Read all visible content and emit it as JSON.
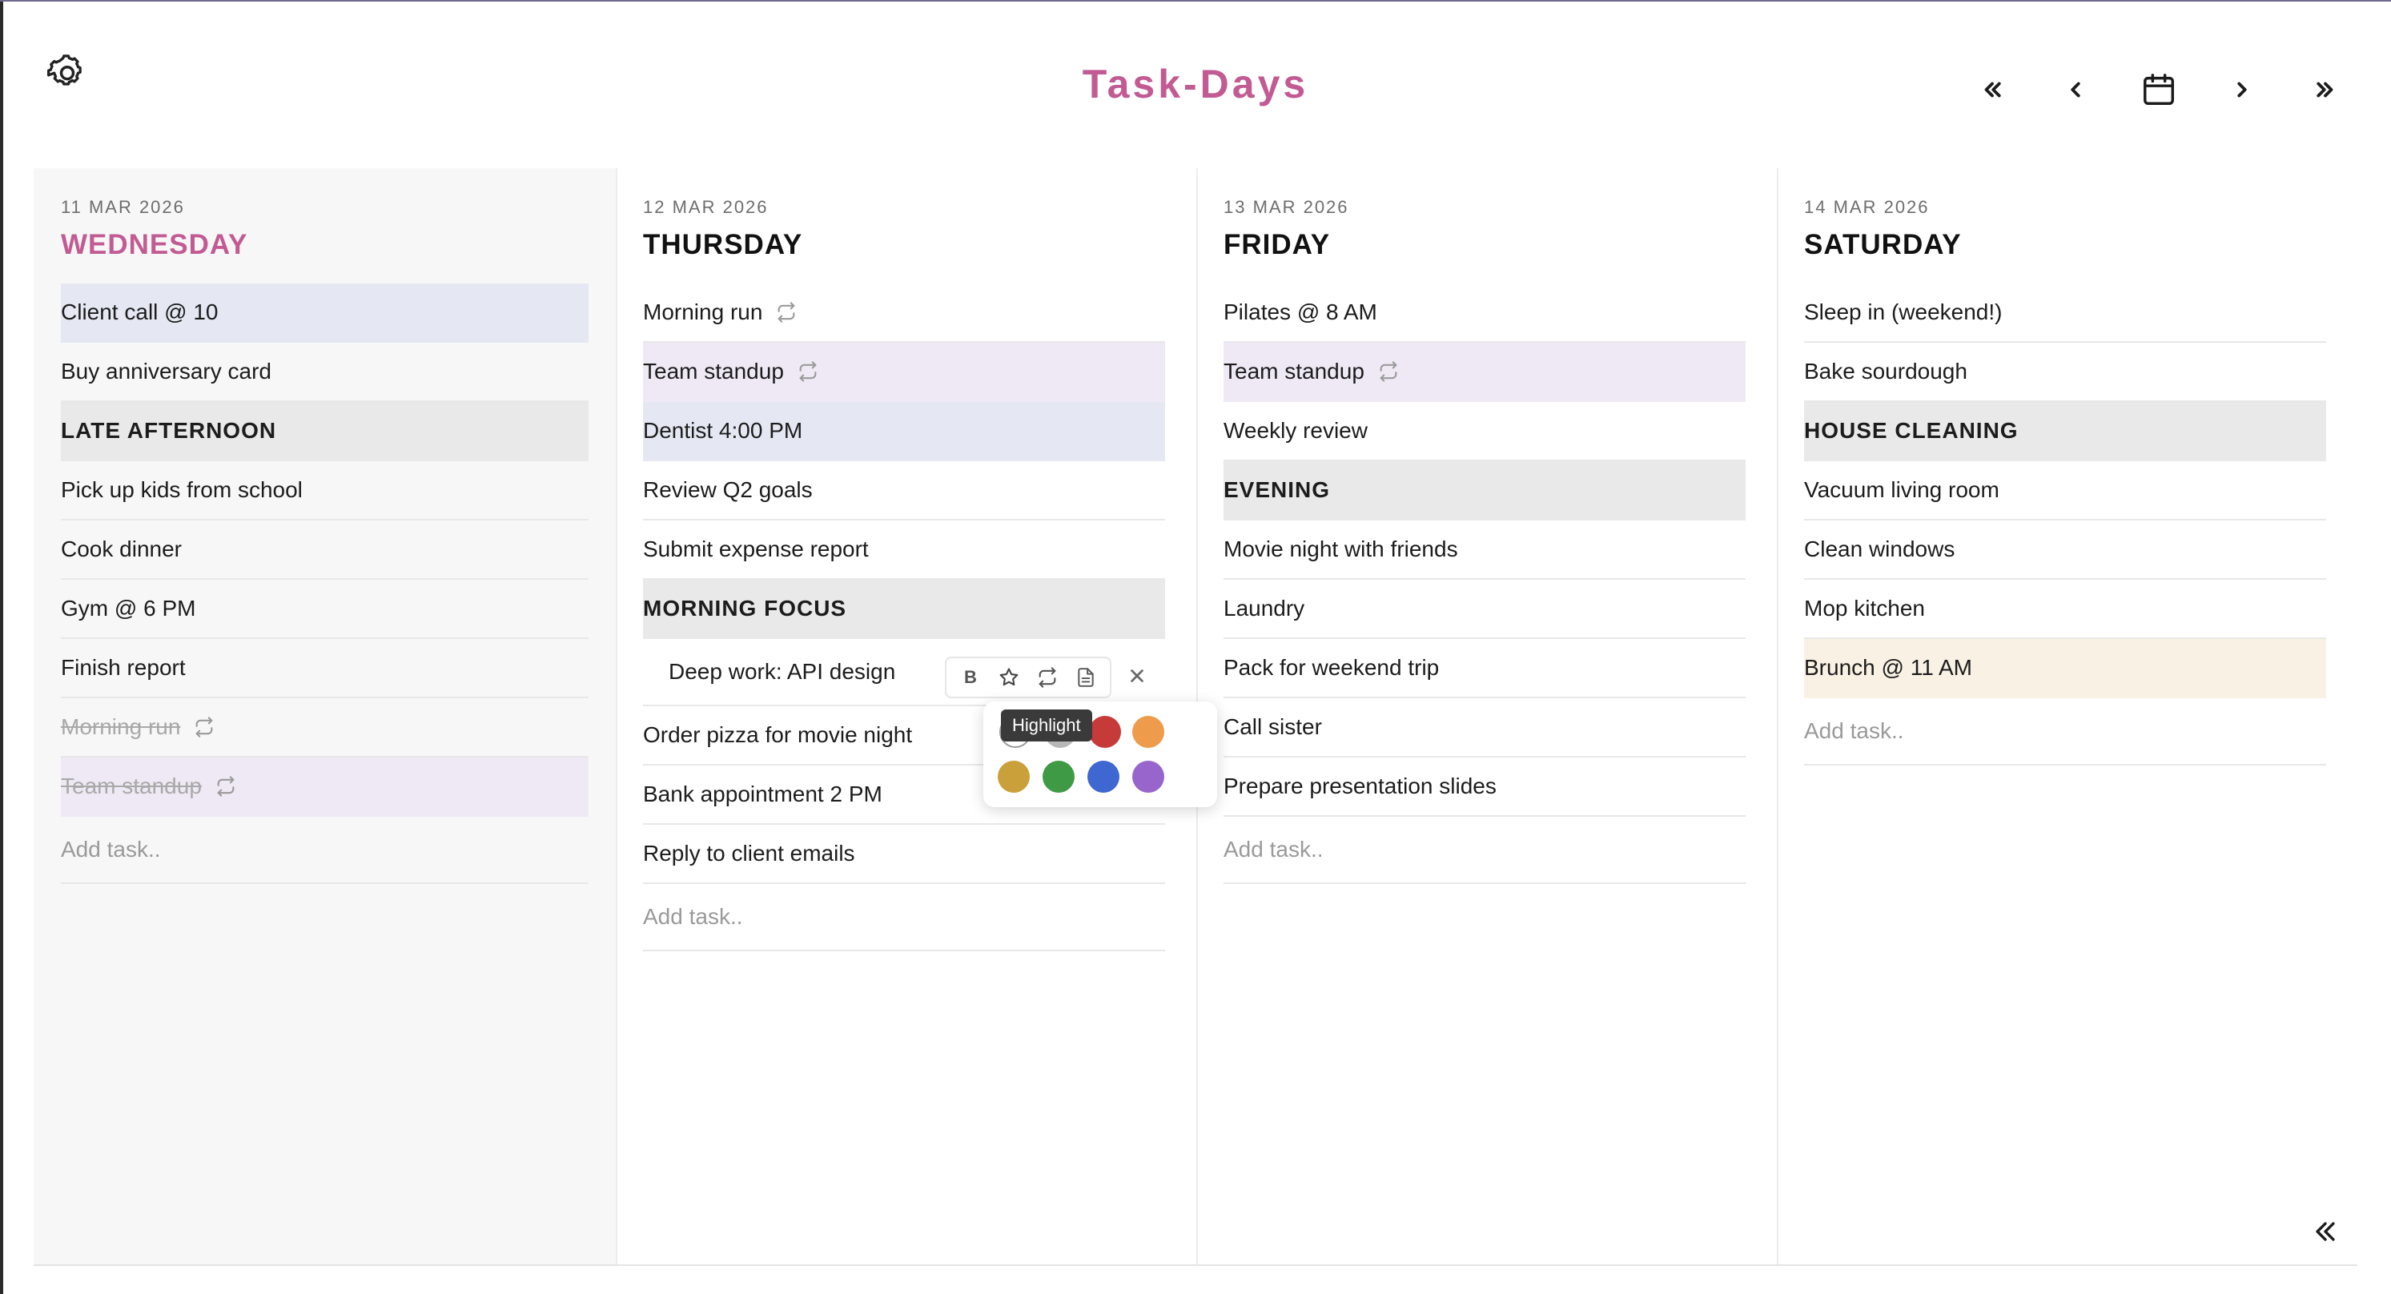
{
  "app": {
    "title": "Task-Days"
  },
  "header": {
    "settings_icon": "gear-icon",
    "nav": [
      {
        "name": "jump-back-button",
        "icon": "double-chevron-left-icon"
      },
      {
        "name": "previous-day-button",
        "icon": "chevron-left-icon"
      },
      {
        "name": "calendar-button",
        "icon": "calendar-icon"
      },
      {
        "name": "next-day-button",
        "icon": "chevron-right-icon"
      },
      {
        "name": "jump-forward-button",
        "icon": "double-chevron-right-icon"
      }
    ]
  },
  "colors": {
    "accent": "#c25b93",
    "section_bg": "#e9e9e9",
    "highlight_blue": "#e5e8f3",
    "highlight_purple": "#efe9f5",
    "highlight_cream": "#f9f1e3"
  },
  "days": [
    {
      "date": "11 MAR 2026",
      "day": "WEDNESDAY",
      "today": true,
      "tasks": [
        {
          "text": "Client call @ 10",
          "highlight": "blue"
        },
        {
          "text": "Buy anniversary card"
        },
        {
          "text": "LATE AFTERNOON",
          "section": true
        },
        {
          "text": "Pick up kids from school"
        },
        {
          "text": "Cook dinner"
        },
        {
          "text": "Gym @ 6 PM"
        },
        {
          "text": "Finish report"
        },
        {
          "text": "Morning run",
          "done": true,
          "repeat": true
        },
        {
          "text": "Team standup",
          "done": true,
          "repeat": true,
          "highlight": "purple"
        }
      ],
      "add_placeholder": "Add task.."
    },
    {
      "date": "12 MAR 2026",
      "day": "THURSDAY",
      "tasks": [
        {
          "text": "Morning run",
          "repeat": true
        },
        {
          "text": "Team standup",
          "repeat": true,
          "highlight": "purple"
        },
        {
          "text": "Dentist 4:00 PM",
          "highlight": "blue"
        },
        {
          "text": "Review Q2 goals"
        },
        {
          "text": "Submit expense report"
        },
        {
          "text": "MORNING FOCUS",
          "section": true
        },
        {
          "text": "Deep work: API design",
          "editing": true
        },
        {
          "text": "Order pizza for movie night"
        },
        {
          "text": "Bank appointment 2 PM"
        },
        {
          "text": "Reply to client emails"
        }
      ],
      "add_placeholder": "Add task.."
    },
    {
      "date": "13 MAR 2026",
      "day": "FRIDAY",
      "tasks": [
        {
          "text": "Pilates @ 8 AM"
        },
        {
          "text": "Team standup",
          "repeat": true,
          "highlight": "purple"
        },
        {
          "text": "Weekly review"
        },
        {
          "text": "EVENING",
          "section": true
        },
        {
          "text": "Movie night with friends"
        },
        {
          "text": "Laundry"
        },
        {
          "text": "Pack for weekend trip"
        },
        {
          "text": "Call sister"
        },
        {
          "text": "Prepare presentation slides"
        }
      ],
      "add_placeholder": "Add task.."
    },
    {
      "date": "14 MAR 2026",
      "day": "SATURDAY",
      "tasks": [
        {
          "text": "Sleep in (weekend!)"
        },
        {
          "text": "Bake sourdough"
        },
        {
          "text": "HOUSE CLEANING",
          "section": true
        },
        {
          "text": "Vacuum living room"
        },
        {
          "text": "Clean windows"
        },
        {
          "text": "Mop kitchen"
        },
        {
          "text": "Brunch @ 11 AM",
          "highlight": "cream"
        }
      ],
      "add_placeholder": "Add task.."
    }
  ],
  "editor": {
    "bold_label": "B",
    "buttons": [
      "bold-button",
      "highlight-button",
      "repeat-button",
      "note-button"
    ],
    "close_icon": "close-icon",
    "tooltip": "Highlight",
    "swatches": [
      {
        "name": "none",
        "color": "#ffffff"
      },
      {
        "name": "gray",
        "color": "#b8b8b8"
      },
      {
        "name": "red",
        "color": "#c73a3a"
      },
      {
        "name": "orange",
        "color": "#ee9b4b"
      },
      {
        "name": "gold",
        "color": "#c9a03a"
      },
      {
        "name": "green",
        "color": "#3f9a45"
      },
      {
        "name": "blue",
        "color": "#3e67d2"
      },
      {
        "name": "purple",
        "color": "#9865cc"
      }
    ]
  },
  "footer": {
    "collapse_icon": "double-chevron-left-icon"
  }
}
